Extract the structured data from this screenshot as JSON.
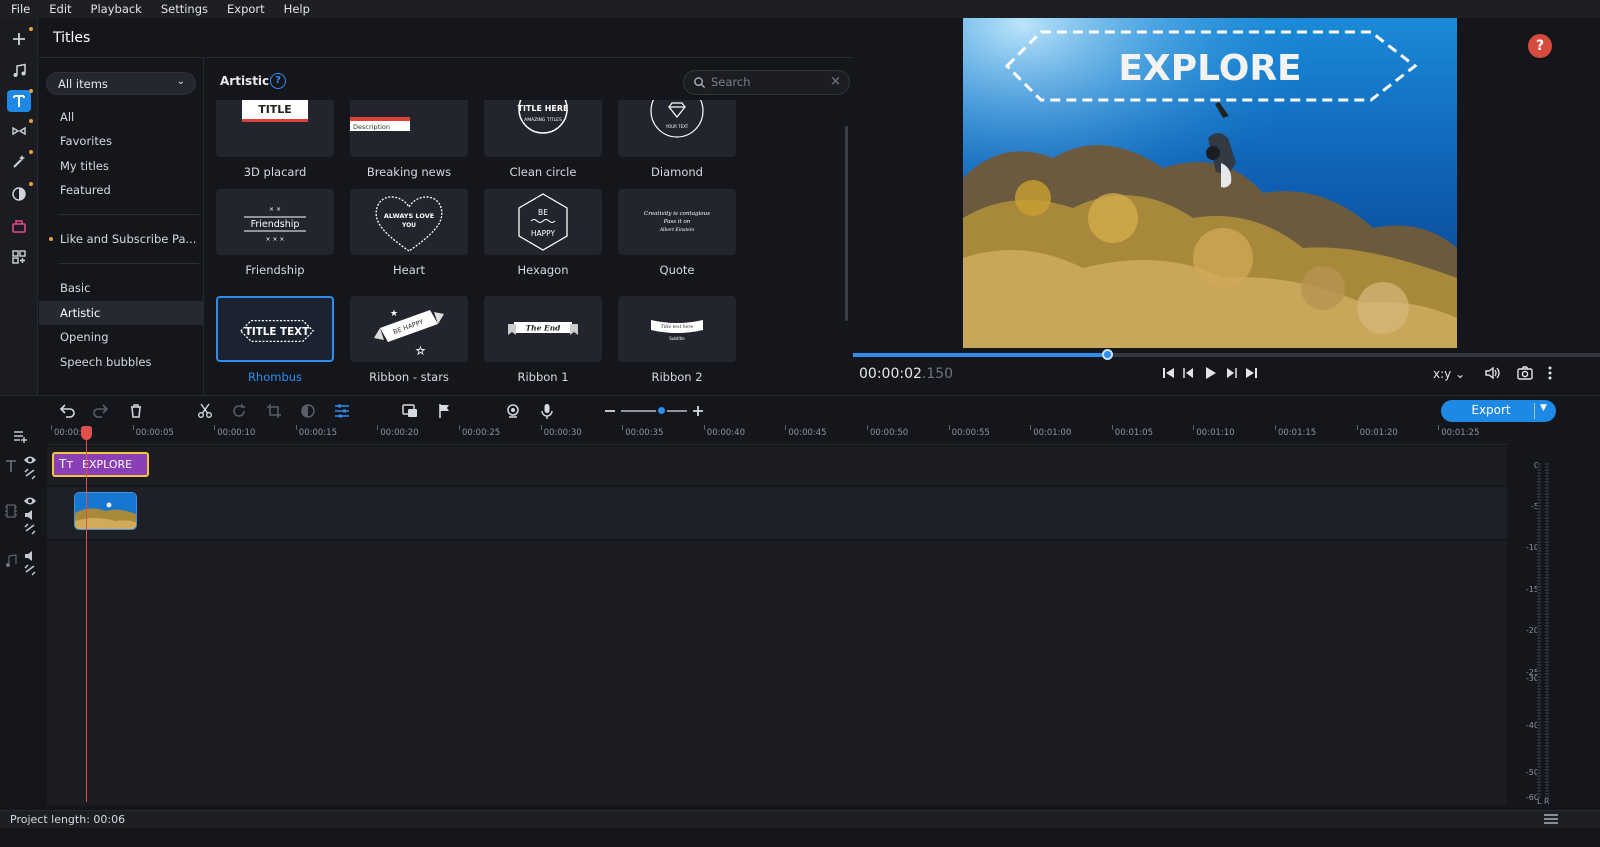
{
  "menu": [
    "File",
    "Edit",
    "Playback",
    "Settings",
    "Export",
    "Help"
  ],
  "rail": {
    "items": [
      {
        "name": "add-icon",
        "dot": true
      },
      {
        "name": "music-icon",
        "dot": false
      },
      {
        "name": "titles-icon",
        "dot": true,
        "active": true
      },
      {
        "name": "transitions-icon",
        "dot": true
      },
      {
        "name": "magic-wand-icon",
        "dot": true
      },
      {
        "name": "filters-icon",
        "dot": true
      },
      {
        "name": "stickers-icon",
        "dot": false
      },
      {
        "name": "more-tools-icon",
        "dot": false
      }
    ]
  },
  "titles_panel": {
    "heading": "Titles",
    "dropdown": "All items",
    "categories": [
      "All",
      "Favorites",
      "My titles",
      "Featured"
    ],
    "special": "Like and Subscribe Pa...",
    "groups": [
      "Basic",
      "Artistic",
      "Opening",
      "Speech bubbles"
    ],
    "selected_group": "Artistic",
    "grid_title": "Artistic",
    "help": "?",
    "search_placeholder": "Search",
    "tiles": [
      {
        "label": "3D placard",
        "thumb_text": "TITLE"
      },
      {
        "label": "Breaking news",
        "thumb_text": "Description"
      },
      {
        "label": "Clean circle",
        "thumb_text": "TITLE HERE",
        "thumb_sub": "AMAZING TITLES"
      },
      {
        "label": "Diamond",
        "thumb_text": "",
        "thumb_sub": "YOUR TEXT"
      },
      {
        "label": "Friendship",
        "thumb_text": "Friendship"
      },
      {
        "label": "Heart",
        "thumb_text": "ALWAYS LOVE",
        "thumb_sub": "YOU"
      },
      {
        "label": "Hexagon",
        "thumb_text": "BE",
        "thumb_sub": "HAPPY"
      },
      {
        "label": "Quote",
        "thumb_text": "Creativity is contagious",
        "thumb_sub": "Pass it on",
        "thumb_sub2": "Albert Einstein"
      },
      {
        "label": "Rhombus",
        "thumb_text": "TITLE TEXT",
        "selected": true
      },
      {
        "label": "Ribbon - stars",
        "thumb_text": "BE HAPPY"
      },
      {
        "label": "Ribbon 1",
        "thumb_text": "The End"
      },
      {
        "label": "Ribbon 2",
        "thumb_text": "Title text here",
        "thumb_sub": "Subtitle"
      }
    ]
  },
  "preview": {
    "overlay_text": "EXPLORE",
    "timecode": "00:00:02",
    "timecode_ms": ".150",
    "aspect": "x:y",
    "help": "?",
    "progress": 0.34
  },
  "toolbar": {
    "export_label": "Export"
  },
  "timeline": {
    "ticks": [
      "00:00:00",
      "00:00:05",
      "00:00:10",
      "00:00:15",
      "00:00:20",
      "00:00:25",
      "00:00:30",
      "00:00:35",
      "00:00:40",
      "00:00:45",
      "00:00:50",
      "00:00:55",
      "00:01:00",
      "00:01:05",
      "00:01:10",
      "00:01:15",
      "00:01:20",
      "00:01:25"
    ],
    "title_clip": "EXPLORE",
    "meter_ticks": [
      "0",
      "-5",
      "-10",
      "-15",
      "-20",
      "-25",
      "-30",
      "-40",
      "-50",
      "-60"
    ],
    "meter_lr": "L  R"
  },
  "status": {
    "project_length": "Project length: 00:06"
  },
  "colors": {
    "accent": "#1e88e5",
    "clip_title": "#8b3fb6",
    "clip_border": "#f2c53d",
    "playhead": "#e0504a"
  }
}
